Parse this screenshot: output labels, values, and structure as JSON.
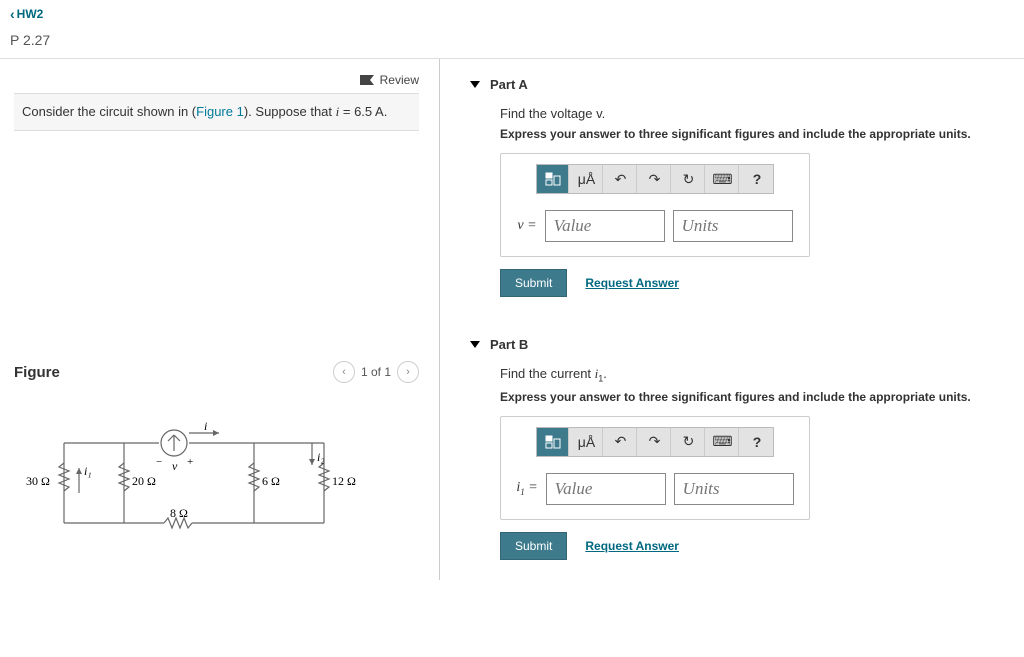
{
  "nav": {
    "back_label": "HW2"
  },
  "problem": {
    "title": "P 2.27"
  },
  "left": {
    "review_label": "Review",
    "intro_prefix": "Consider the circuit shown in (",
    "figure_link": "Figure 1",
    "intro_suffix": "). Suppose that ",
    "var": "i",
    "eq": " = 6.5 A.",
    "figure_heading": "Figure",
    "pager_text": "1 of 1"
  },
  "circuit": {
    "r30": "30 Ω",
    "r20": "20 Ω",
    "r6": "6 Ω",
    "r12": "12 Ω",
    "r8": "8 Ω",
    "i": "i",
    "i1": "i₁",
    "i2": "i₂",
    "v": "v",
    "plus": "+",
    "minus": "−"
  },
  "partA": {
    "title": "Part A",
    "find": "Find the voltage v.",
    "instruct": "Express your answer to three significant figures and include the appropriate units.",
    "eq_label": "v =",
    "value_ph": "Value",
    "units_ph": "Units",
    "submit": "Submit",
    "request": "Request Answer",
    "toolbar": {
      "mua": "μÅ",
      "undo": "↶",
      "redo": "↷",
      "reset": "↻",
      "kb": "⌨",
      "help": "?"
    }
  },
  "partB": {
    "title": "Part B",
    "find_prefix": "Find the current ",
    "find_var": "i",
    "find_sub": "1",
    "find_suffix": ".",
    "instruct": "Express your answer to three significant figures and include the appropriate units.",
    "eq_label": "i",
    "eq_sub": "1",
    "eq_after": " =",
    "value_ph": "Value",
    "units_ph": "Units",
    "submit": "Submit",
    "request": "Request Answer",
    "toolbar": {
      "mua": "μÅ",
      "undo": "↶",
      "redo": "↷",
      "reset": "↻",
      "kb": "⌨",
      "help": "?"
    }
  }
}
